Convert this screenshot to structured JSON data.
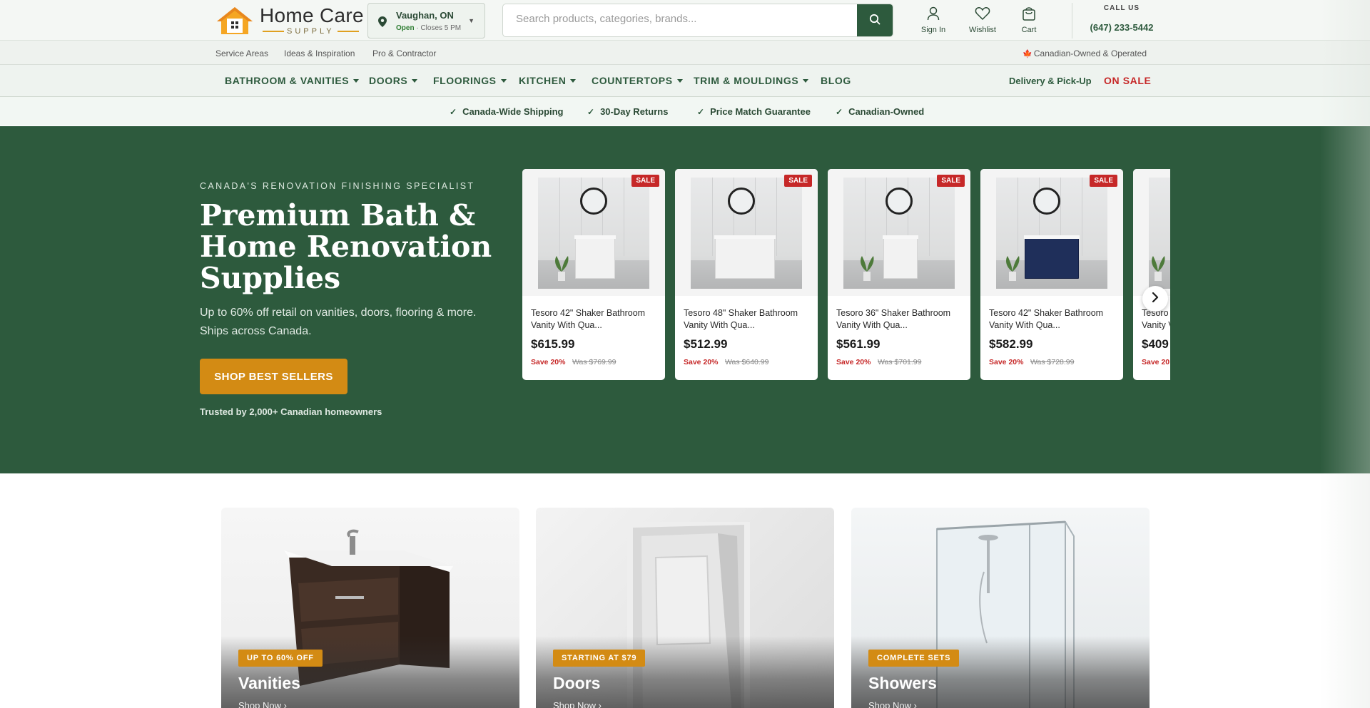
{
  "header": {
    "logo_title": "Home Care",
    "logo_sub": "SUPPLY",
    "store": {
      "city": "Vaughan, ON",
      "status": "Open",
      "hours": " · Closes 5 PM"
    },
    "search": {
      "placeholder": "Search products, categories, brands..."
    },
    "actions": [
      {
        "label": "Sign In",
        "icon": "user-icon"
      },
      {
        "label": "Wishlist",
        "icon": "heart-icon"
      },
      {
        "label": "Cart",
        "icon": "bag-icon"
      }
    ],
    "call": {
      "label": "CALL US",
      "number": "(647) 233-5442"
    }
  },
  "utility": {
    "links": [
      "Service Areas",
      "Ideas & Inspiration",
      "Pro & Contractor"
    ],
    "canadian": "Canadian-Owned & Operated"
  },
  "nav": {
    "items": [
      "BATHROOM & VANITIES",
      "DOORS",
      "FLOORINGS",
      "KITCHEN",
      "COUNTERTOPS",
      "TRIM & MOULDINGS",
      "BLOG"
    ],
    "delivery": "Delivery & Pick-Up",
    "sale": "ON SALE"
  },
  "benefits": [
    "Canada-Wide Shipping",
    "30-Day Returns",
    "Price Match Guarantee",
    "Canadian-Owned"
  ],
  "hero": {
    "eyebrow": "CANADA'S RENOVATION FINISHING SPECIALIST",
    "title": "Premium Bath & Home Renovation Supplies",
    "subtitle": "Up to 60% off retail on vanities, doors, flooring & more. Ships across Canada.",
    "cta": "SHOP BEST SELLERS",
    "trust": "Trusted by 2,000+ Canadian homeowners"
  },
  "products": [
    {
      "name": "Tesoro 42\" Shaker Bathroom Vanity With Qua...",
      "price": "$615.99",
      "save": "Save 20%",
      "was": "Was $769.99",
      "badge": "SALE"
    },
    {
      "name": "Tesoro 48\" Shaker Bathroom Vanity With Qua...",
      "price": "$512.99",
      "save": "Save 20%",
      "was": "Was $640.99",
      "badge": "SALE"
    },
    {
      "name": "Tesoro 36\" Shaker Bathroom Vanity With Qua...",
      "price": "$561.99",
      "save": "Save 20%",
      "was": "Was $701.99",
      "badge": "SALE"
    },
    {
      "name": "Tesoro 42\" Shaker Bathroom Vanity With Qua...",
      "price": "$582.99",
      "save": "Save 20%",
      "was": "Was $728.99",
      "badge": "SALE"
    },
    {
      "name": "Tesoro",
      "name2": "Vanity V",
      "price": "$409",
      "save": "Save 20"
    }
  ],
  "categories": [
    {
      "badge": "UP TO 60% OFF",
      "title": "Vanities",
      "link": "Shop Now ›"
    },
    {
      "badge": "STARTING AT $79",
      "title": "Doors",
      "link": "Shop Now ›"
    },
    {
      "badge": "COMPLETE SETS",
      "title": "Showers",
      "link": "Shop Now ›"
    }
  ],
  "colors": {
    "brand_green": "#2d5a3d",
    "accent_orange": "#d38b14",
    "sale_red": "#c62828"
  }
}
